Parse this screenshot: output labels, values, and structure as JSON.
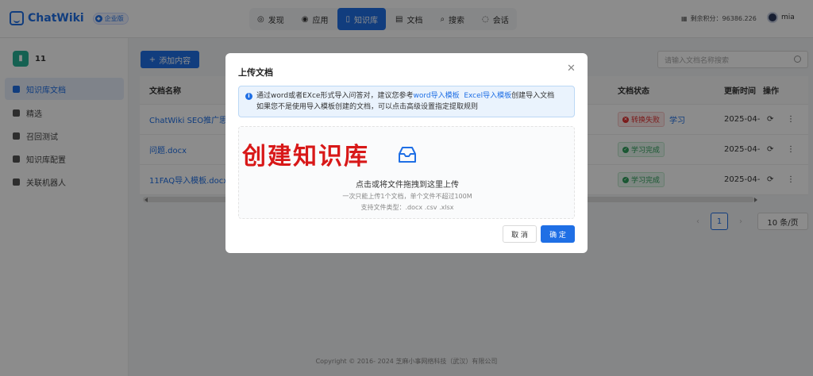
{
  "header": {
    "brand": "ChatWiki",
    "edition": "企业版",
    "nav": [
      {
        "icon": "discover-icon",
        "label": "发现",
        "active": false
      },
      {
        "icon": "apps-icon",
        "label": "应用",
        "active": false
      },
      {
        "icon": "knowledge-base-icon",
        "label": "知识库",
        "active": true
      },
      {
        "icon": "document-icon",
        "label": "文档",
        "active": false
      },
      {
        "icon": "search-icon",
        "label": "搜索",
        "active": false
      },
      {
        "icon": "chat-icon",
        "label": "会话",
        "active": false
      }
    ],
    "points_label": "剩余积分：96386.226",
    "username": "mia"
  },
  "sidebar": {
    "kb_name": "11",
    "items": [
      {
        "label": "知识库文档",
        "active": true
      },
      {
        "label": "精选",
        "active": false
      },
      {
        "label": "召回测试",
        "active": false
      },
      {
        "label": "知识库配置",
        "active": false
      },
      {
        "label": "关联机器人",
        "active": false
      }
    ]
  },
  "main": {
    "add_button": "添加内容",
    "search_placeholder": "请输入文档名称搜索",
    "columns": {
      "name": "文档名称",
      "status": "文档状态",
      "updated": "更新时间",
      "actions": "操作"
    },
    "rows": [
      {
        "name": "ChatWiki SEO推广思路.",
        "status": "转换失败",
        "status_type": "fail",
        "extra": "学习",
        "updated": "2025-04-"
      },
      {
        "name": "问题.docx",
        "status": "学习完成",
        "status_type": "ok",
        "extra": "",
        "updated": "2025-04-"
      },
      {
        "name": "11FAQ导入模板.docx",
        "status": "学习完成",
        "status_type": "ok",
        "extra": "",
        "updated": "2025-04-"
      }
    ],
    "pagination": {
      "current": "1",
      "page_size": "10 条/页"
    }
  },
  "footer": "Copyright © 2016- 2024 芝麻小事网络科技（武汉）有限公司",
  "modal": {
    "title": "上传文档",
    "notice_prefix": "通过word或者EXce形式导入问答对，建议您参考",
    "notice_link1": "word导入模板",
    "notice_link2": "Excel导入模板",
    "notice_suffix": "创建导入文档",
    "notice_line2": "如果您不是使用导入模板创建的文档，可以点击高级设置指定提取规则",
    "watermark": "创建知识库",
    "drop_main": "点击或将文件拖拽到这里上传",
    "drop_sub1": "一次只能上传1个文档，单个文件不超过100M",
    "drop_sub2": "支持文件类型：.docx .csv .xlsx",
    "cancel": "取 消",
    "confirm": "确 定"
  }
}
